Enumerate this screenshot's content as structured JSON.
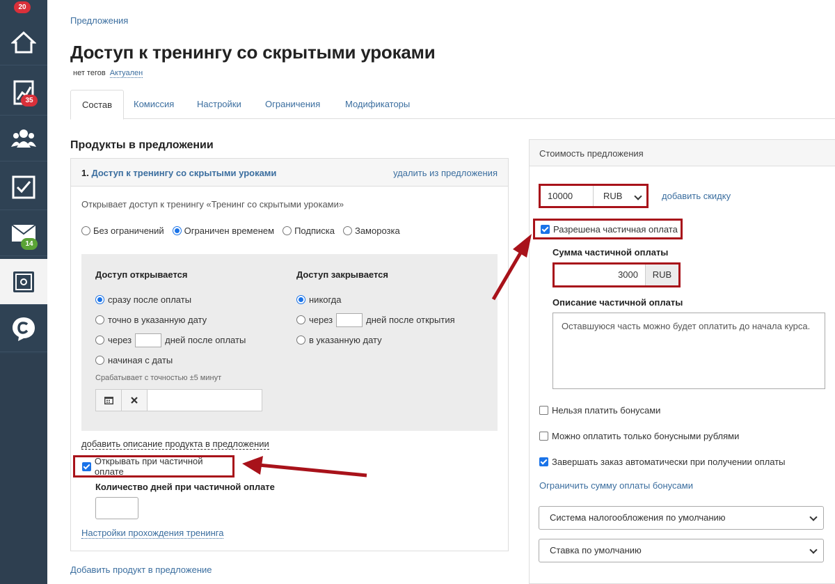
{
  "sidebar": {
    "top_badge": "20",
    "items": [
      {
        "icon": "home-icon",
        "badge": ""
      },
      {
        "icon": "chart-icon",
        "badge": "35",
        "badge_color": "#d9303a"
      },
      {
        "icon": "users-icon",
        "badge": ""
      },
      {
        "icon": "tasks-icon",
        "badge": ""
      },
      {
        "icon": "mail-icon",
        "badge": "14",
        "badge_color": "#5aa336"
      },
      {
        "icon": "safe-icon",
        "badge": "",
        "active": true
      },
      {
        "icon": "chat-logo-icon",
        "badge": ""
      }
    ]
  },
  "breadcrumb": "Предложения",
  "title": "Доступ к тренингу со скрытыми уроками",
  "tags": "нет тегов",
  "status": "Актуален",
  "tabs": [
    "Состав",
    "Комиссия",
    "Настройки",
    "Ограничения",
    "Модификаторы"
  ],
  "products": {
    "section_title": "Продукты в предложении",
    "item_number": "1.",
    "item_name": "Доступ к тренингу со скрытыми уроками",
    "remove": "удалить из предложения",
    "description": "Открывает доступ к тренингу «Тренинг со скрытыми уроками»",
    "limit_options": [
      "Без ограничений",
      "Ограничен временем",
      "Подписка",
      "Заморозка"
    ],
    "access_open": {
      "title": "Доступ открывается",
      "opt1": "сразу после оплаты",
      "opt2": "точно в указанную дату",
      "opt3_before": "через",
      "opt3_after": "дней после оплаты",
      "opt4": "начиная с даты"
    },
    "access_close": {
      "title": "Доступ закрывается",
      "opt1": "никогда",
      "opt2_before": "через",
      "opt2_after": "дней после открытия",
      "opt3": "в указанную дату"
    },
    "accuracy_hint": "Срабатывает с точностью ±5 минут",
    "add_description": "добавить описание продукта в предложении",
    "open_on_partial": "Открывать при частичной оплате",
    "days_label": "Количество дней при частичной оплате",
    "training_settings": "Настройки прохождения тренинга",
    "add_product": "Добавить продукт в предложение"
  },
  "price": {
    "header": "Стоимость предложения",
    "amount": "10000",
    "currency": "RUB",
    "add_discount": "добавить скидку",
    "partial_allowed": "Разрешена частичная оплата",
    "partial_sum_label": "Сумма частичной оплаты",
    "partial_sum": "3000",
    "partial_currency": "RUB",
    "partial_desc_label": "Описание частичной оплаты",
    "partial_desc": "Оставшуюся часть можно будет оплатить до начала курса.",
    "no_bonus": "Нельзя платить бонусами",
    "bonus_only": "Можно оплатить только бонусными рублями",
    "auto_complete": "Завершать заказ автоматически при получении оплаты",
    "limit_bonus": "Ограничить сумму оплаты бонусами",
    "tax_system": "Система налогообложения по умолчанию",
    "tax_rate": "Ставка по умолчанию"
  },
  "colors": {
    "highlight": "#a8121a",
    "link": "#3b6e9f",
    "sidebar": "#2f4254"
  }
}
